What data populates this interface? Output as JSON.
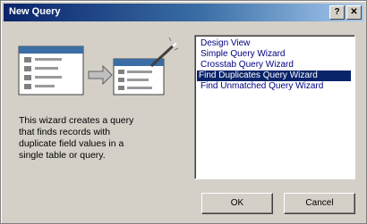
{
  "window": {
    "title": "New Query",
    "help_label": "?",
    "close_label": "✕"
  },
  "description": "This wizard creates a query\nthat finds records with\nduplicate field values in a\nsingle table or query.",
  "query_list": {
    "items": [
      "Design View",
      "Simple Query Wizard",
      "Crosstab Query Wizard",
      "Find Duplicates Query Wizard",
      "Find Unmatched Query Wizard"
    ],
    "selected_index": 3
  },
  "buttons": {
    "ok_label": "OK",
    "cancel_label": "Cancel"
  },
  "colors": {
    "title_bar": "#0a246a",
    "selection": "#0a246a",
    "list_text": "#000080",
    "dialog_face": "#d4d0c8"
  },
  "icons": [
    "table-icon",
    "wizard-wand-icon",
    "help-icon",
    "close-icon"
  ]
}
